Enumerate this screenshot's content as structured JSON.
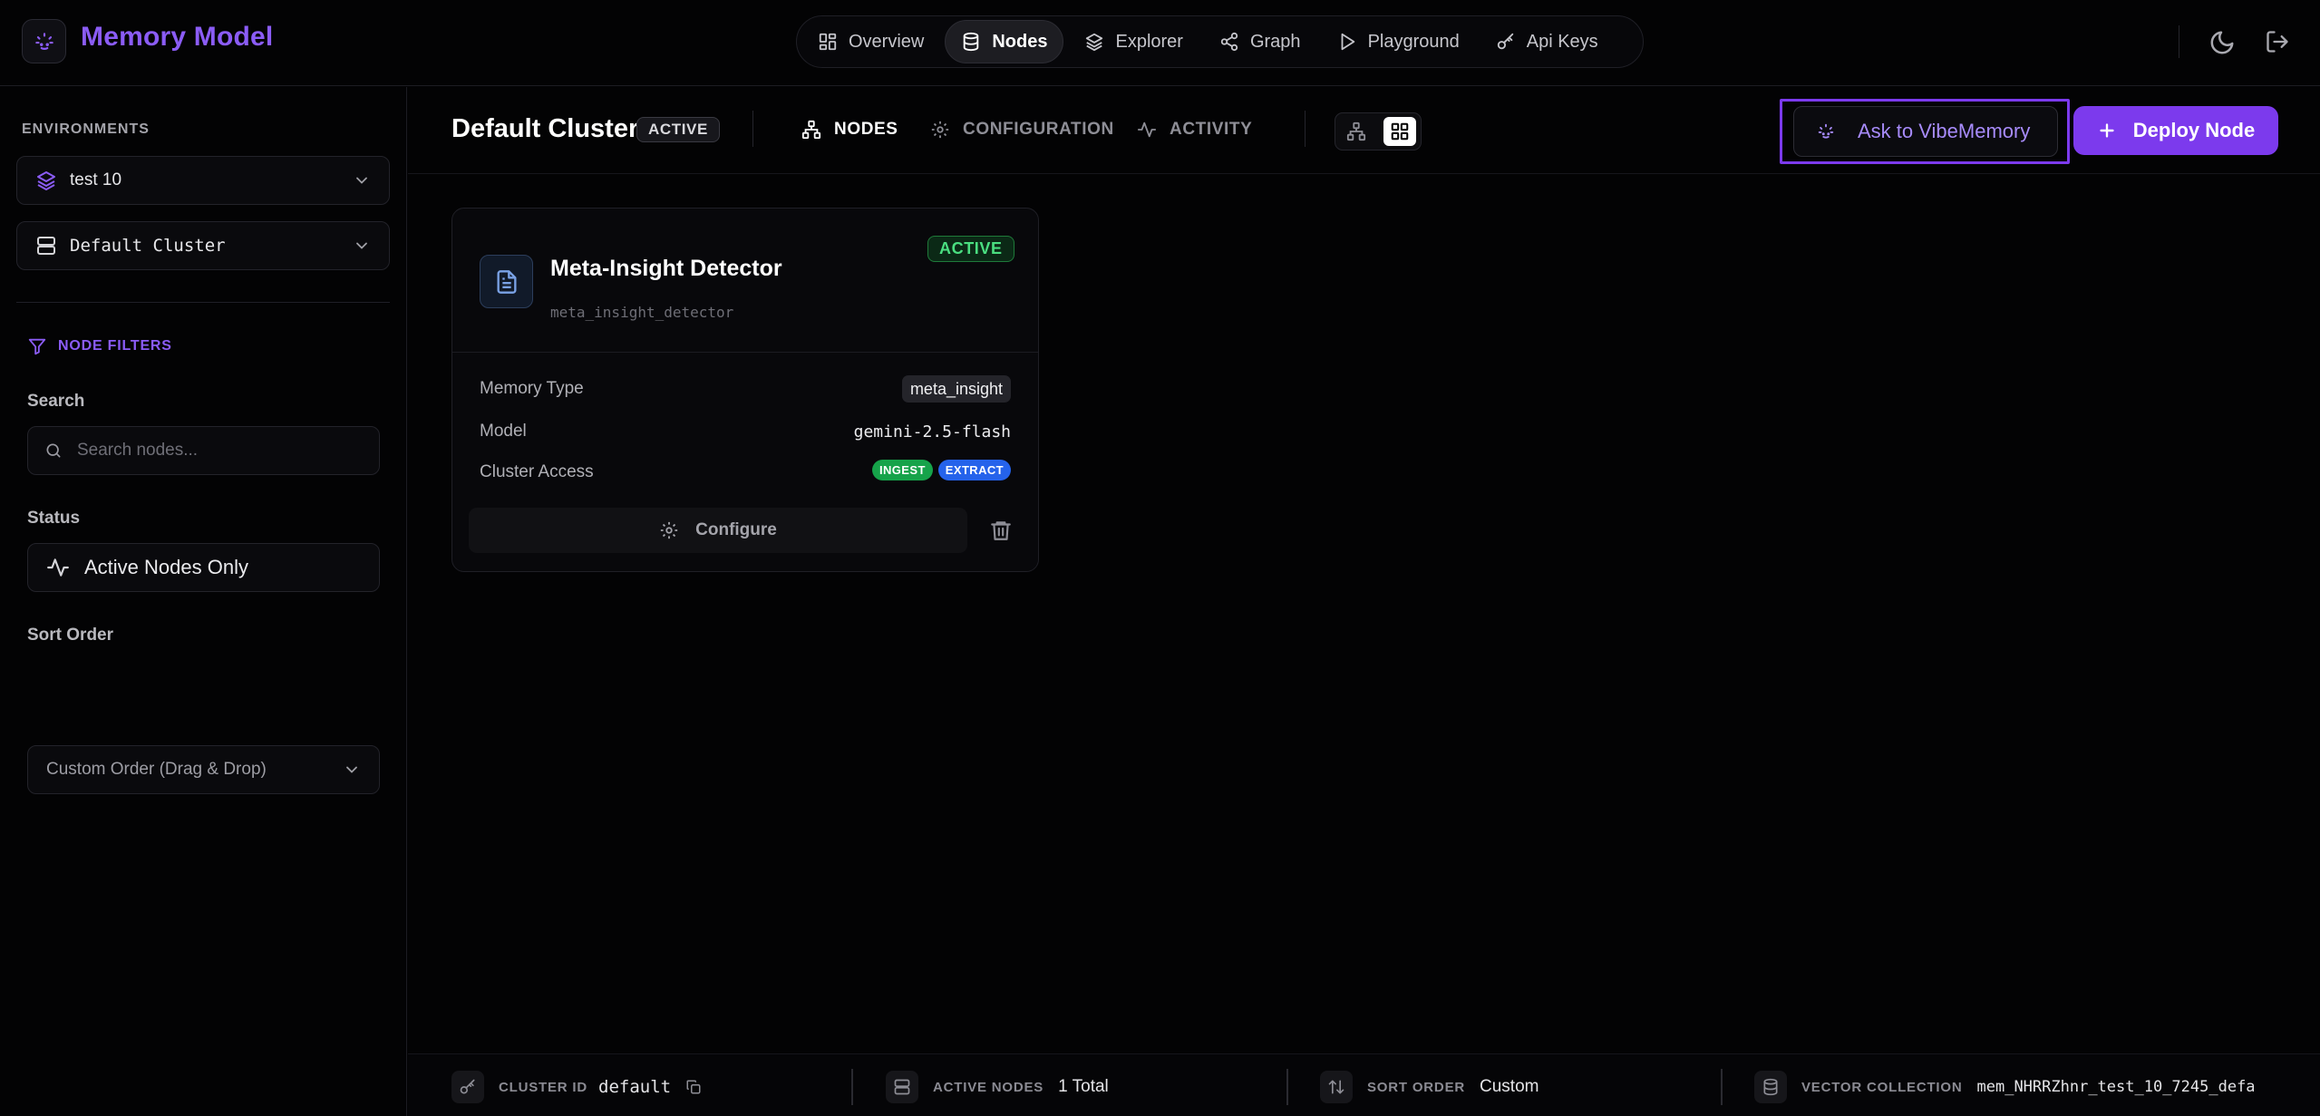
{
  "app": {
    "title": "Memory Model"
  },
  "nav": {
    "items": [
      {
        "label": "Overview",
        "icon": "grid-icon",
        "active": false
      },
      {
        "label": "Nodes",
        "icon": "database-icon",
        "active": true
      },
      {
        "label": "Explorer",
        "icon": "layers-icon",
        "active": false
      },
      {
        "label": "Graph",
        "icon": "share-icon",
        "active": false
      },
      {
        "label": "Playground",
        "icon": "play-icon",
        "active": false
      },
      {
        "label": "Api Keys",
        "icon": "key-icon",
        "active": false
      }
    ]
  },
  "sidebar": {
    "environments_label": "ENVIRONMENTS",
    "environment": "test 10",
    "cluster": "Default Cluster",
    "filters_title": "NODE FILTERS",
    "search_label": "Search",
    "search_placeholder": "Search nodes...",
    "status_label": "Status",
    "status_value": "Active Nodes Only",
    "sort_label": "Sort Order",
    "sort_value": "Custom Order (Drag & Drop)"
  },
  "header": {
    "cluster_title": "Default Cluster",
    "cluster_status": "ACTIVE",
    "tabs": [
      {
        "label": "NODES",
        "active": true
      },
      {
        "label": "CONFIGURATION",
        "active": false
      },
      {
        "label": "ACTIVITY",
        "active": false
      }
    ],
    "ask_label": "Ask to VibeMemory",
    "deploy_label": "Deploy Node"
  },
  "card": {
    "title": "Meta-Insight Detector",
    "subtitle": "meta_insight_detector",
    "status": "ACTIVE",
    "memory_type_label": "Memory Type",
    "memory_type_value": "meta_insight",
    "model_label": "Model",
    "model_value": "gemini-2.5-flash",
    "access_label": "Cluster Access",
    "access_chips": [
      "INGEST",
      "EXTRACT"
    ],
    "configure_label": "Configure"
  },
  "footer": {
    "cluster_id_label": "CLUSTER ID",
    "cluster_id_value": "default",
    "active_nodes_label": "ACTIVE NODES",
    "active_nodes_value": "1 Total",
    "sort_order_label": "SORT ORDER",
    "sort_order_value": "Custom",
    "vector_label": "VECTOR COLLECTION",
    "vector_value": "mem_NHRRZhnr_test_10_7245_defa"
  },
  "colors": {
    "accent": "#7c3aed",
    "accent_text": "#8b5cf6",
    "active_green": "#4ade80",
    "ingest_chip": "#16a34a",
    "extract_chip": "#2563eb"
  }
}
